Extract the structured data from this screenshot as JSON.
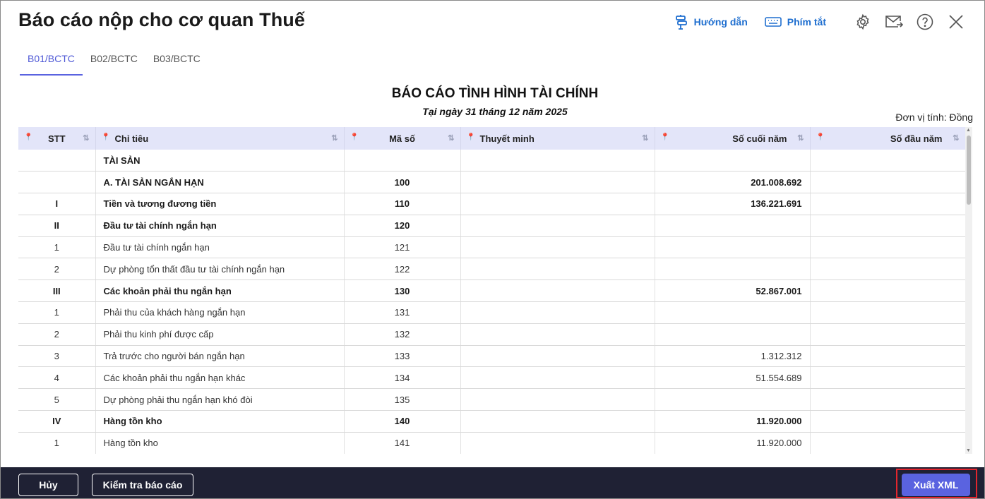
{
  "window": {
    "title": "Báo cáo nộp cho cơ quan Thuế"
  },
  "toolbar": {
    "guide_label": "Hướng dẫn",
    "shortcut_label": "Phím tắt"
  },
  "tabs": [
    {
      "label": "B01/BCTC",
      "active": true
    },
    {
      "label": "B02/BCTC",
      "active": false
    },
    {
      "label": "B03/BCTC",
      "active": false
    }
  ],
  "report": {
    "title": "BÁO CÁO TÌNH HÌNH TÀI CHÍNH",
    "date": "Tại ngày 31 tháng 12 năm 2025",
    "unit": "Đơn vị tính: Đồng"
  },
  "table": {
    "columns": [
      "STT",
      "Chỉ tiêu",
      "Mã số",
      "Thuyết minh",
      "Số cuối năm",
      "Số đầu năm"
    ],
    "rows": [
      {
        "stt": "",
        "chi_tieu": "TÀI SẢN",
        "ma_so": "",
        "thuyet_minh": "",
        "so_cuoi_nam": "",
        "so_dau_nam": "",
        "bold": true
      },
      {
        "stt": "",
        "chi_tieu": "A. TÀI SẢN NGẮN HẠN",
        "ma_so": "100",
        "thuyet_minh": "",
        "so_cuoi_nam": "201.008.692",
        "so_dau_nam": "",
        "bold": true
      },
      {
        "stt": "I",
        "chi_tieu": "Tiền và tương đương tiền",
        "ma_so": "110",
        "thuyet_minh": "",
        "so_cuoi_nam": "136.221.691",
        "so_dau_nam": "",
        "bold": true
      },
      {
        "stt": "II",
        "chi_tieu": "Đầu tư tài chính ngắn hạn",
        "ma_so": "120",
        "thuyet_minh": "",
        "so_cuoi_nam": "",
        "so_dau_nam": "",
        "bold": true
      },
      {
        "stt": "1",
        "chi_tieu": "Đầu tư tài chính ngắn hạn",
        "ma_so": "121",
        "thuyet_minh": "",
        "so_cuoi_nam": "",
        "so_dau_nam": "",
        "bold": false
      },
      {
        "stt": "2",
        "chi_tieu": "Dự phòng tổn thất đầu tư tài chính ngắn hạn",
        "ma_so": "122",
        "thuyet_minh": "",
        "so_cuoi_nam": "",
        "so_dau_nam": "",
        "bold": false
      },
      {
        "stt": "III",
        "chi_tieu": "Các khoản phải thu ngắn hạn",
        "ma_so": "130",
        "thuyet_minh": "",
        "so_cuoi_nam": "52.867.001",
        "so_dau_nam": "",
        "bold": true
      },
      {
        "stt": "1",
        "chi_tieu": "Phải thu của khách hàng ngắn hạn",
        "ma_so": "131",
        "thuyet_minh": "",
        "so_cuoi_nam": "",
        "so_dau_nam": "",
        "bold": false
      },
      {
        "stt": "2",
        "chi_tieu": "Phải thu kinh phí được cấp",
        "ma_so": "132",
        "thuyet_minh": "",
        "so_cuoi_nam": "",
        "so_dau_nam": "",
        "bold": false
      },
      {
        "stt": "3",
        "chi_tieu": "Trả trước cho người bán ngắn hạn",
        "ma_so": "133",
        "thuyet_minh": "",
        "so_cuoi_nam": "1.312.312",
        "so_dau_nam": "",
        "bold": false
      },
      {
        "stt": "4",
        "chi_tieu": "Các khoản phải thu ngắn hạn khác",
        "ma_so": "134",
        "thuyet_minh": "",
        "so_cuoi_nam": "51.554.689",
        "so_dau_nam": "",
        "bold": false
      },
      {
        "stt": "5",
        "chi_tieu": "Dự phòng phải thu ngắn hạn khó đòi",
        "ma_so": "135",
        "thuyet_minh": "",
        "so_cuoi_nam": "",
        "so_dau_nam": "",
        "bold": false
      },
      {
        "stt": "IV",
        "chi_tieu": "Hàng tồn kho",
        "ma_so": "140",
        "thuyet_minh": "",
        "so_cuoi_nam": "11.920.000",
        "so_dau_nam": "",
        "bold": true
      },
      {
        "stt": "1",
        "chi_tieu": "Hàng tồn kho",
        "ma_so": "141",
        "thuyet_minh": "",
        "so_cuoi_nam": "11.920.000",
        "so_dau_nam": "",
        "bold": false
      },
      {
        "stt": "",
        "chi_tieu": "",
        "ma_so": "",
        "thuyet_minh": "",
        "so_cuoi_nam": "",
        "so_dau_nam": "",
        "bold": false
      }
    ]
  },
  "footer": {
    "cancel_label": "Hủy",
    "check_label": "Kiểm tra báo cáo",
    "export_label": "Xuất XML"
  },
  "colors": {
    "accent": "#5a63e0",
    "link": "#1e6ecf",
    "footer_bg": "#1f2134",
    "header_row_bg": "#e3e5f9",
    "highlight": "#e3262d"
  }
}
